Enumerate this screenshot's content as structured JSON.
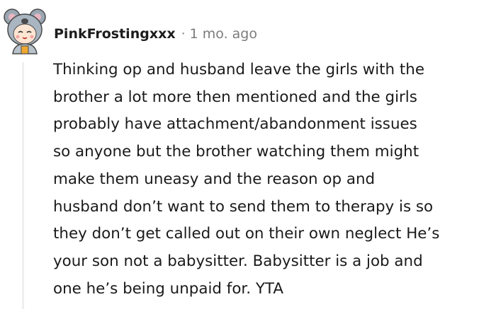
{
  "comment": {
    "author": "PinkFrostingxxx",
    "separator": "·",
    "timestamp": "1 mo. ago",
    "avatar_icon": "koala-avatar-icon",
    "body_lines": [
      "Thinking op and husband leave the girls with the",
      "brother a lot more then mentioned and the girls",
      "probably have attachment/abandonment issues",
      "so anyone but the brother watching them might",
      "make them uneasy and the reason op and",
      "husband don’t want to send them to therapy is so",
      "they don’t get called out on their own neglect He’s",
      "your son not a babysitter. Babysitter is a job and",
      "one he’s being unpaid for. YTA"
    ]
  },
  "colors": {
    "username": "#1c1c1c",
    "meta": "#7c7c7c",
    "thread_line": "#edeff1",
    "body": "#1a1a1b"
  }
}
